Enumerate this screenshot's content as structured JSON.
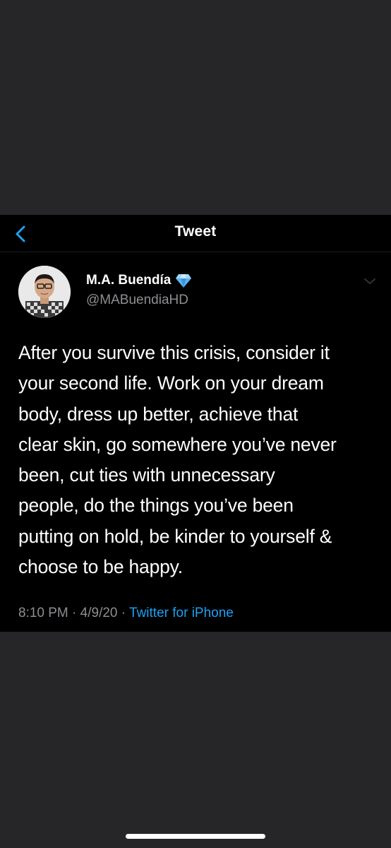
{
  "nav": {
    "title": "Tweet",
    "back_icon": "chevron-left-icon",
    "accent_color": "#1da1f2"
  },
  "author": {
    "name": "M.A. Buendía",
    "handle": "@MABuendiaHD",
    "badge_icon": "diamond-icon",
    "menu_icon": "chevron-down-icon"
  },
  "tweet": {
    "lines": [
      "After you survive this crisis, consider it",
      "your second life. Work on your dream",
      "body, dress up better, achieve that",
      "clear skin, go somewhere you’ve never",
      "been, cut ties with unnecessary",
      "people, do the things you’ve been",
      "putting on hold, be kinder to yourself &",
      "choose to be happy."
    ],
    "time": "8:10 PM",
    "separator": "·",
    "date": "4/9/20",
    "source": "Twitter for iPhone"
  },
  "colors": {
    "background": "#262628",
    "panel": "#000000",
    "text": "#ffffff",
    "muted": "#8e8e93"
  }
}
